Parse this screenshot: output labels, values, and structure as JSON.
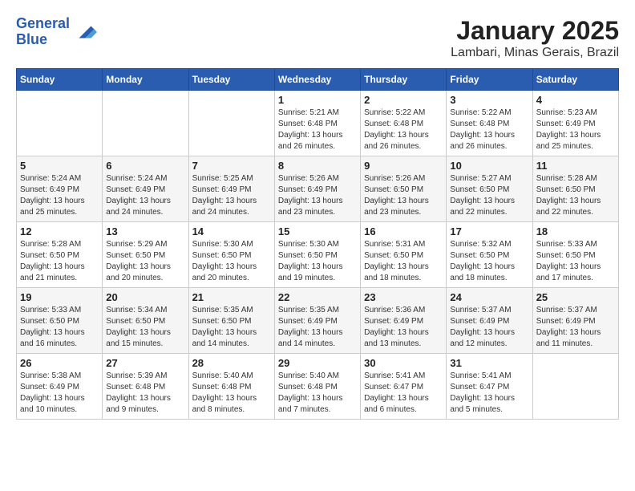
{
  "header": {
    "logo_line1": "General",
    "logo_line2": "Blue",
    "title": "January 2025",
    "subtitle": "Lambari, Minas Gerais, Brazil"
  },
  "weekdays": [
    "Sunday",
    "Monday",
    "Tuesday",
    "Wednesday",
    "Thursday",
    "Friday",
    "Saturday"
  ],
  "weeks": [
    [
      {
        "day": "",
        "info": ""
      },
      {
        "day": "",
        "info": ""
      },
      {
        "day": "",
        "info": ""
      },
      {
        "day": "1",
        "info": "Sunrise: 5:21 AM\nSunset: 6:48 PM\nDaylight: 13 hours and 26 minutes."
      },
      {
        "day": "2",
        "info": "Sunrise: 5:22 AM\nSunset: 6:48 PM\nDaylight: 13 hours and 26 minutes."
      },
      {
        "day": "3",
        "info": "Sunrise: 5:22 AM\nSunset: 6:48 PM\nDaylight: 13 hours and 26 minutes."
      },
      {
        "day": "4",
        "info": "Sunrise: 5:23 AM\nSunset: 6:49 PM\nDaylight: 13 hours and 25 minutes."
      }
    ],
    [
      {
        "day": "5",
        "info": "Sunrise: 5:24 AM\nSunset: 6:49 PM\nDaylight: 13 hours and 25 minutes."
      },
      {
        "day": "6",
        "info": "Sunrise: 5:24 AM\nSunset: 6:49 PM\nDaylight: 13 hours and 24 minutes."
      },
      {
        "day": "7",
        "info": "Sunrise: 5:25 AM\nSunset: 6:49 PM\nDaylight: 13 hours and 24 minutes."
      },
      {
        "day": "8",
        "info": "Sunrise: 5:26 AM\nSunset: 6:49 PM\nDaylight: 13 hours and 23 minutes."
      },
      {
        "day": "9",
        "info": "Sunrise: 5:26 AM\nSunset: 6:50 PM\nDaylight: 13 hours and 23 minutes."
      },
      {
        "day": "10",
        "info": "Sunrise: 5:27 AM\nSunset: 6:50 PM\nDaylight: 13 hours and 22 minutes."
      },
      {
        "day": "11",
        "info": "Sunrise: 5:28 AM\nSunset: 6:50 PM\nDaylight: 13 hours and 22 minutes."
      }
    ],
    [
      {
        "day": "12",
        "info": "Sunrise: 5:28 AM\nSunset: 6:50 PM\nDaylight: 13 hours and 21 minutes."
      },
      {
        "day": "13",
        "info": "Sunrise: 5:29 AM\nSunset: 6:50 PM\nDaylight: 13 hours and 20 minutes."
      },
      {
        "day": "14",
        "info": "Sunrise: 5:30 AM\nSunset: 6:50 PM\nDaylight: 13 hours and 20 minutes."
      },
      {
        "day": "15",
        "info": "Sunrise: 5:30 AM\nSunset: 6:50 PM\nDaylight: 13 hours and 19 minutes."
      },
      {
        "day": "16",
        "info": "Sunrise: 5:31 AM\nSunset: 6:50 PM\nDaylight: 13 hours and 18 minutes."
      },
      {
        "day": "17",
        "info": "Sunrise: 5:32 AM\nSunset: 6:50 PM\nDaylight: 13 hours and 18 minutes."
      },
      {
        "day": "18",
        "info": "Sunrise: 5:33 AM\nSunset: 6:50 PM\nDaylight: 13 hours and 17 minutes."
      }
    ],
    [
      {
        "day": "19",
        "info": "Sunrise: 5:33 AM\nSunset: 6:50 PM\nDaylight: 13 hours and 16 minutes."
      },
      {
        "day": "20",
        "info": "Sunrise: 5:34 AM\nSunset: 6:50 PM\nDaylight: 13 hours and 15 minutes."
      },
      {
        "day": "21",
        "info": "Sunrise: 5:35 AM\nSunset: 6:50 PM\nDaylight: 13 hours and 14 minutes."
      },
      {
        "day": "22",
        "info": "Sunrise: 5:35 AM\nSunset: 6:49 PM\nDaylight: 13 hours and 14 minutes."
      },
      {
        "day": "23",
        "info": "Sunrise: 5:36 AM\nSunset: 6:49 PM\nDaylight: 13 hours and 13 minutes."
      },
      {
        "day": "24",
        "info": "Sunrise: 5:37 AM\nSunset: 6:49 PM\nDaylight: 13 hours and 12 minutes."
      },
      {
        "day": "25",
        "info": "Sunrise: 5:37 AM\nSunset: 6:49 PM\nDaylight: 13 hours and 11 minutes."
      }
    ],
    [
      {
        "day": "26",
        "info": "Sunrise: 5:38 AM\nSunset: 6:49 PM\nDaylight: 13 hours and 10 minutes."
      },
      {
        "day": "27",
        "info": "Sunrise: 5:39 AM\nSunset: 6:48 PM\nDaylight: 13 hours and 9 minutes."
      },
      {
        "day": "28",
        "info": "Sunrise: 5:40 AM\nSunset: 6:48 PM\nDaylight: 13 hours and 8 minutes."
      },
      {
        "day": "29",
        "info": "Sunrise: 5:40 AM\nSunset: 6:48 PM\nDaylight: 13 hours and 7 minutes."
      },
      {
        "day": "30",
        "info": "Sunrise: 5:41 AM\nSunset: 6:47 PM\nDaylight: 13 hours and 6 minutes."
      },
      {
        "day": "31",
        "info": "Sunrise: 5:41 AM\nSunset: 6:47 PM\nDaylight: 13 hours and 5 minutes."
      },
      {
        "day": "",
        "info": ""
      }
    ]
  ]
}
